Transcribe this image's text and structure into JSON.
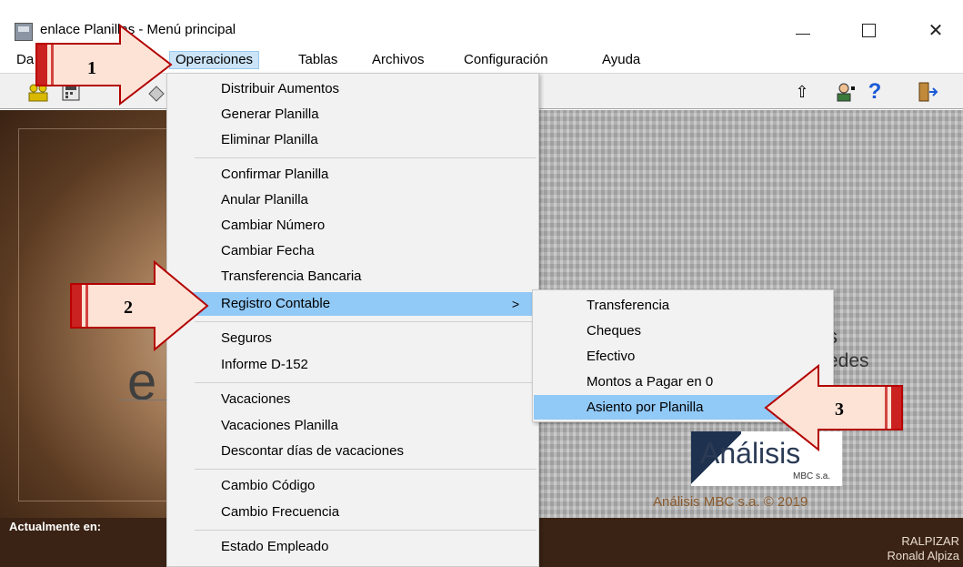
{
  "window": {
    "title": "enlace Planillas - Menú principal",
    "minimize_icon": "minimize-icon",
    "maximize_icon": "maximize-icon",
    "close_glyph": "✕"
  },
  "menubar": {
    "items": [
      "Da",
      "Operaciones",
      "Tablas",
      "Archivos",
      "Configuración",
      "Ayuda"
    ]
  },
  "toolbar": {
    "icons": [
      "people-icon",
      "calculator-icon",
      "tool-icon",
      "eraser-icon",
      "up-arrow-icon",
      "user-help-icon",
      "help-icon",
      "exit-door-icon"
    ],
    "up_glyph": "⇧",
    "help_glyph": "?"
  },
  "operaciones_menu": {
    "items": [
      "Distribuir Aumentos",
      "Generar Planilla",
      "Eliminar Planilla",
      "Confirmar Planilla",
      "Anular Planilla",
      "Cambiar Número",
      "Cambiar Fecha",
      "Transferencia Bancaria",
      "Registro Contable",
      "Seguros",
      "Informe D-152",
      "Vacaciones",
      "Vacaciones Planilla",
      "Descontar días de vacaciones",
      "Cambio Código",
      "Cambio Frecuencia",
      "Estado Empleado"
    ],
    "submenu_arrow": ">"
  },
  "registro_contable_submenu": {
    "items": [
      "Transferencia",
      "Cheques",
      "Efectivo",
      "Montos a Pagar en 0",
      "Asiento por Planilla"
    ]
  },
  "background": {
    "big_letter": "e",
    "brand_fragment_s": "s",
    "brand_fragment_redes": "redes",
    "logo_text": "Análisis",
    "logo_sub": "MBC s.a.",
    "copyright": "Análisis MBC s.a. © 2019"
  },
  "status": {
    "label": "Actualmente en:",
    "user_code": "RALPIZAR",
    "user_name": "Ronald Alpiza"
  },
  "annotations": {
    "step1": "1",
    "step2": "2",
    "step3": "3",
    "arrow_fill": "#fde3d6",
    "arrow_stroke": "#b30000"
  }
}
